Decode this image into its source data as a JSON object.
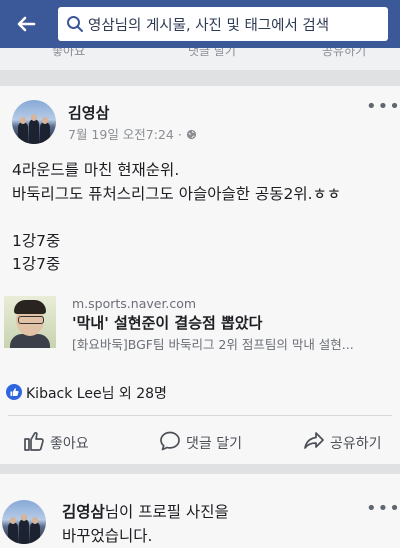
{
  "search": {
    "query": "영삼님의 게시물, 사진 및 태그에서 검색"
  },
  "prev_post": {
    "like": "좋아요",
    "comment": "댓글 달기",
    "share": "공유하기"
  },
  "post": {
    "author": "김영삼",
    "timestamp": "7월 19일 오전7:24 · ",
    "lines": [
      "4라운드를 마친 현재순위.",
      "바둑리그도 퓨처스리그도 아슬아슬한 공동2위.ㅎㅎ",
      "1강7중",
      "1강7중"
    ],
    "link": {
      "domain": "m.sports.naver.com",
      "title": "'막내' 설현준이 결승점 뽑았다",
      "description": "[화요바둑]BGF팀 바둑리그 2위 점프팀의 막내 설현..."
    },
    "reactions": {
      "name": "Kiback Lee",
      "suffix": "님 외 28명"
    },
    "actions": {
      "like": "좋아요",
      "comment": "댓글 달기",
      "share": "공유하기"
    }
  },
  "next_post": {
    "author": "김영삼",
    "line1_suffix": "님이 프로필 사진을",
    "line2": "바꾸었습니다."
  },
  "colors": {
    "header": "#3b5898",
    "like_badge": "#2f66e0"
  }
}
